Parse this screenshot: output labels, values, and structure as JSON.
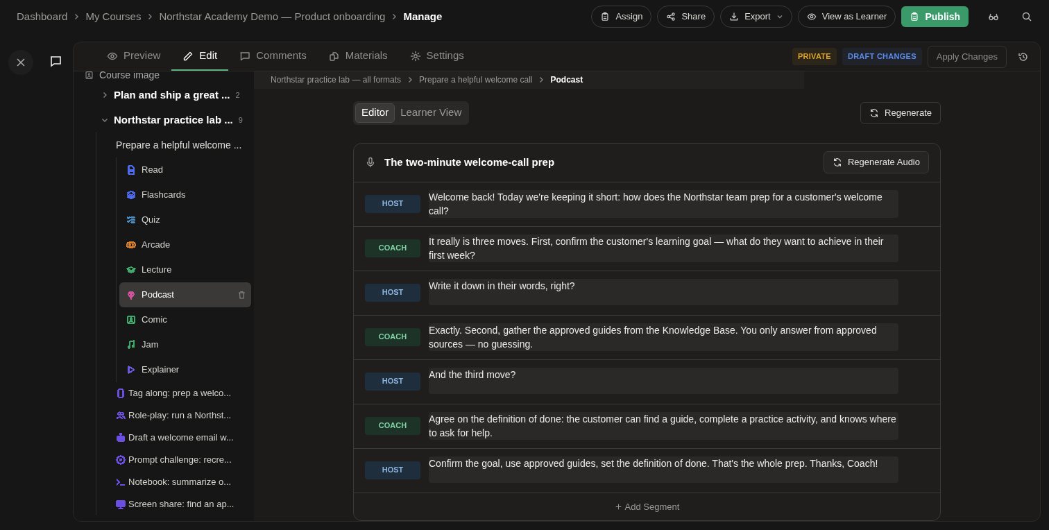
{
  "breadcrumb": [
    "Dashboard",
    "My Courses",
    "Northstar Academy Demo — Product onboarding",
    "Manage"
  ],
  "top_actions": [
    {
      "label": "Assign"
    },
    {
      "label": "Share"
    },
    {
      "label": "Export",
      "dropdown": true
    },
    {
      "label": "View as Learner"
    }
  ],
  "publish_button": "Publish",
  "tabs": [
    {
      "label": "Preview",
      "selected": false
    },
    {
      "label": "Edit",
      "selected": true
    },
    {
      "label": "Comments",
      "selected": false
    },
    {
      "label": "Materials",
      "selected": false
    },
    {
      "label": "Settings",
      "selected": false
    }
  ],
  "badges": [
    {
      "label": "PRIVATE",
      "color": "#e0a526"
    },
    {
      "label": "DRAFT CHANGES",
      "color": "#5b8def"
    }
  ],
  "apply_button": "Apply Changes",
  "sidebar": {
    "top_item": "Course image",
    "items": [
      {
        "label": "Plan and ship a great ...",
        "count": "2",
        "expanded": false
      },
      {
        "label": "Northstar practice lab ...",
        "count": "9",
        "expanded": true,
        "children": [
          {
            "label": "Prepare a helpful welcome ...",
            "children": [
              {
                "label": "Read",
                "kind": "read",
                "color": "#4f6bed",
                "selected": false
              },
              {
                "label": "Flashcards",
                "kind": "layers",
                "color": "#4f6bed",
                "selected": false
              },
              {
                "label": "Quiz",
                "kind": "checklist",
                "color": "#4a90c8",
                "selected": false
              },
              {
                "label": "Arcade",
                "kind": "gamepad",
                "color": "#d9822b",
                "selected": false
              },
              {
                "label": "Lecture",
                "kind": "cap",
                "color": "#3fa86b",
                "selected": false
              },
              {
                "label": "Podcast",
                "kind": "podcast",
                "color": "#d0529a",
                "selected": true
              },
              {
                "label": "Comic",
                "kind": "image",
                "color": "#3fa86b",
                "selected": false
              },
              {
                "label": "Jam",
                "kind": "music",
                "color": "#3fa86b",
                "selected": false
              },
              {
                "label": "Explainer",
                "kind": "play",
                "color": "#6a5ae0",
                "selected": false
              }
            ]
          },
          {
            "label": "Tag along: prep a welco...",
            "kind": "phone",
            "color": "#6a4fe0"
          },
          {
            "label": "Role-play: run a Northst...",
            "kind": "people",
            "color": "#6a4fe0"
          },
          {
            "label": "Draft a welcome email w...",
            "kind": "robot",
            "color": "#6a4fe0"
          },
          {
            "label": "Prompt challenge: recre...",
            "kind": "target",
            "color": "#6a4fe0"
          },
          {
            "label": "Notebook: summarize o...",
            "kind": "terminal",
            "color": "#6a4fe0"
          },
          {
            "label": "Screen share: find an ap...",
            "kind": "monitor",
            "color": "#6a4fe0"
          }
        ]
      }
    ]
  },
  "content_breadcrumb": [
    "Northstar practice lab — all formats",
    "Prepare a helpful welcome call",
    "Podcast"
  ],
  "view_toggle": [
    {
      "label": "Editor",
      "selected": true
    },
    {
      "label": "Learner View",
      "selected": false
    }
  ],
  "regenerate_button": "Regenerate",
  "podcast": {
    "title": "The two-minute welcome-call prep",
    "regenerate_audio": "Regenerate Audio",
    "segments": [
      {
        "speaker": "HOST",
        "text": "Welcome back! Today we're keeping it short: how does the Northstar team prep for a customer's welcome call?"
      },
      {
        "speaker": "COACH",
        "text": "It really is three moves. First, confirm the customer's learning goal — what do they want to achieve in their first week?"
      },
      {
        "speaker": "HOST",
        "text": "Write it down in their words, right?"
      },
      {
        "speaker": "COACH",
        "text": "Exactly. Second, gather the approved guides from the Knowledge Base. You only answer from approved sources — no guessing."
      },
      {
        "speaker": "HOST",
        "text": "And the third move?"
      },
      {
        "speaker": "COACH",
        "text": "Agree on the definition of done: the customer can find a guide, complete a practice activity, and knows where to ask for help."
      },
      {
        "speaker": "HOST",
        "text": "Confirm the goal, use approved guides, set the definition of done. That's the whole prep. Thanks, Coach!"
      }
    ],
    "add_segment": "Add Segment"
  }
}
